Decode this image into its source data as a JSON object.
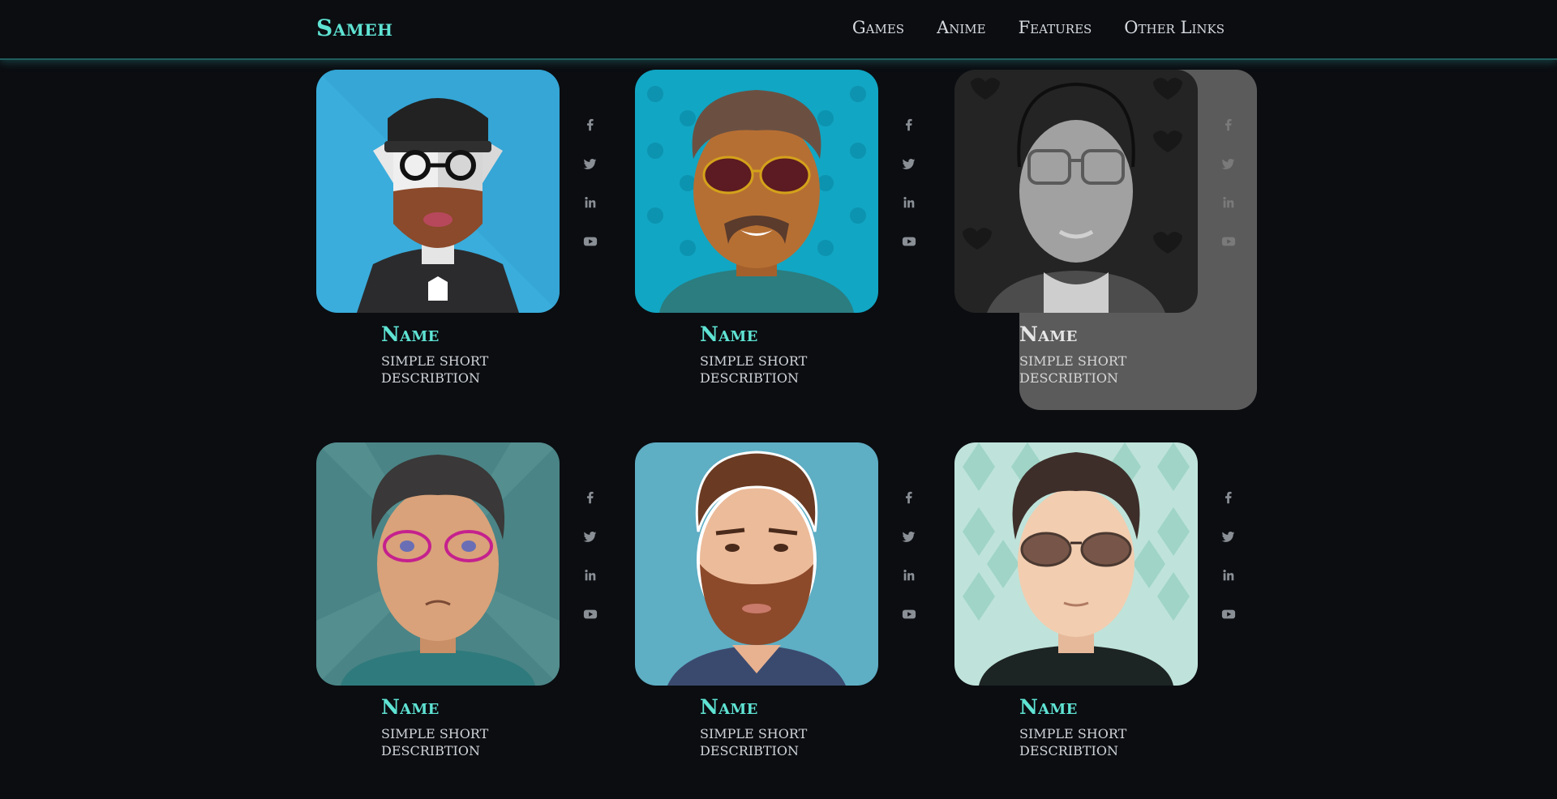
{
  "navbar": {
    "brand": "Sameh",
    "links": [
      "Games",
      "Anime",
      "Features",
      "Other Links"
    ]
  },
  "colors": {
    "accent": "#5fe3d3",
    "background": "#0b0d11",
    "hover_card": "#5b5b5b"
  },
  "social_icons": [
    "facebook-icon",
    "twitter-icon",
    "linkedin-icon",
    "youtube-icon"
  ],
  "cards": [
    {
      "name": "Name",
      "description": "simple short describtion",
      "avatar": "bearded-beanie-man-avatar",
      "hovered": false
    },
    {
      "name": "Name",
      "description": "simple short describtion",
      "avatar": "mustache-sunglasses-man-avatar",
      "hovered": false
    },
    {
      "name": "Name",
      "description": "simple short describtion",
      "avatar": "glasses-man-avatar",
      "hovered": true
    },
    {
      "name": "Name",
      "description": "simple short describtion",
      "avatar": "pink-glasses-man-avatar",
      "hovered": false
    },
    {
      "name": "Name",
      "description": "simple short describtion",
      "avatar": "bearded-man-avatar",
      "hovered": false
    },
    {
      "name": "Name",
      "description": "simple short describtion",
      "avatar": "aviator-glasses-man-avatar",
      "hovered": false
    }
  ]
}
